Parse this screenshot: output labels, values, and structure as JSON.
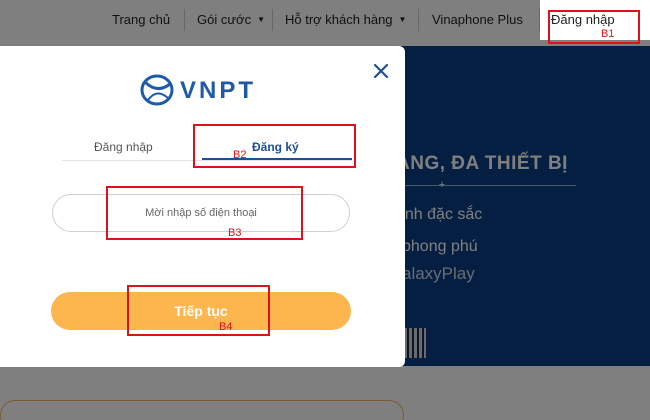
{
  "nav": {
    "items": [
      {
        "label": "Trang chủ"
      },
      {
        "label": "Gói cước"
      },
      {
        "label": "Hỗ trợ khách hàng"
      },
      {
        "label": "Vinaphone Plus"
      }
    ],
    "login_label": "Đăng nhập",
    "dropdown_caret": "▼"
  },
  "banner": {
    "headline": "ẠNG, ĐA THIẾT BỊ",
    "divider_symbol": "+",
    "line1": "ênh đặc sắc",
    "line2": "phong phú",
    "line3": "alaxyPlay"
  },
  "modal": {
    "logo_text": "VNPT",
    "close_symbol": "×",
    "tabs": [
      {
        "label": "Đăng nhập"
      },
      {
        "label": "Đăng ký",
        "active": true
      }
    ],
    "phone_placeholder": "Mời nhập số điện thoại",
    "continue_label": "Tiếp tục"
  },
  "annotations": {
    "b1": "B1",
    "b2": "B2",
    "b3": "B3",
    "b4": "B4",
    "color": "#e0101c"
  },
  "colors": {
    "brand_blue": "#1f4e98",
    "button_orange": "#fdb64e",
    "banner_navy": "#0b3f86"
  }
}
